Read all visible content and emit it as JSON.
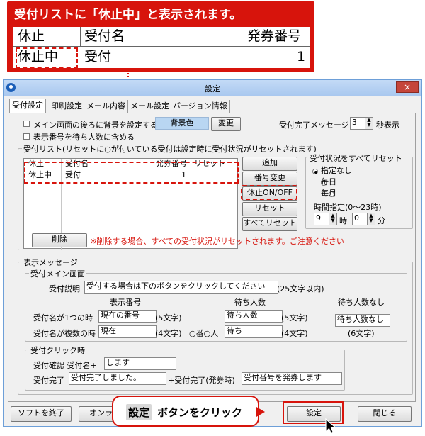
{
  "callout": {
    "title": "受付リストに「休止中」と表示されます。",
    "headers": [
      "休止",
      "受付名",
      "発券番号"
    ],
    "row": {
      "pause": "休止中",
      "name": "受付",
      "number": "1"
    }
  },
  "dialog": {
    "title": "設定",
    "close": "×",
    "tabs": [
      "受付設定",
      "印刷設定",
      "メール内容",
      "メール設定",
      "バージョン情報"
    ]
  },
  "settings": {
    "bg_check": "メイン画面の後ろに背景を設定する",
    "bg_color_label": "背景色",
    "bg_change": "変更",
    "complete_msg_label": "受付完了メッセージ:",
    "complete_msg_value": "3",
    "seconds_label": "秒表示",
    "include_pause_check": "表示番号を待ち人数に含める"
  },
  "reception_list": {
    "legend": "受付リスト(リセットに○が付いている受付は設定時に受付状況がリセットされます)",
    "headers": [
      "休止",
      "受付名",
      "発券番号",
      "リセット"
    ],
    "rows": [
      {
        "pause": "休止中",
        "name": "受付",
        "number": "1",
        "reset": ""
      }
    ],
    "buttons": {
      "add": "追加",
      "change_no": "番号変更",
      "pause_toggle": "休止ON/OFF",
      "reset": "リセット",
      "reset_all": "すべてリセット"
    },
    "delete": "削除",
    "delete_warning": "※削除する場合、すべての受付状況がリセットされます。ご注意ください"
  },
  "reset_all_group": {
    "legend": "受付状況をすべてリセット",
    "options": [
      "指定なし",
      "毎日",
      "毎月"
    ],
    "selected": "指定なし",
    "time_label": "時間指定(0〜23時)",
    "hour_value": "9",
    "hour_unit": "時",
    "minute_value": "0",
    "minute_unit": "分"
  },
  "display_msg": {
    "legend": "表示メッセージ",
    "main_legend": "受付メイン画面",
    "desc_label": "受付説明",
    "desc_value": "受付する場合は下のボタンをクリックしてください",
    "desc_limit": "(25文字以内)",
    "col_display": "表示番号",
    "col_waiting": "待ち人数",
    "col_none": "待ち人数なし",
    "single_label": "受付名が1つの時",
    "single_value": "現在の番号",
    "single_limit": "(5文字)",
    "single_wait": "待ち人数",
    "single_wait_limit": "(5文字)",
    "none_value": "待ち人数なし",
    "none_limit": "(6文字)",
    "multi_label": "受付名が複数の時",
    "multi_value": "現在",
    "multi_limit": "(4文字)",
    "multi_suffix": "○番○人",
    "multi_wait": "待ち",
    "multi_wait_limit": "(4文字)",
    "click_legend": "受付クリック時",
    "confirm_label": "受付確認 受付名+",
    "confirm_value": "します",
    "complete_label": "受付完了",
    "complete_value": "受付完了しました。",
    "complete_ticket_label": "+受付完了(発券時)",
    "complete_ticket_value": "受付番号を発券します"
  },
  "footer": {
    "quit": "ソフトを終了",
    "online": "オンラ",
    "setting": "設定",
    "close": "閉じる"
  },
  "hint": {
    "pill": "設定",
    "text": "ボタンをクリック"
  },
  "colors": {
    "accent_red": "#d7140c",
    "bg_swatch": "#b9d6f2",
    "warning_text": "#d7140c"
  }
}
